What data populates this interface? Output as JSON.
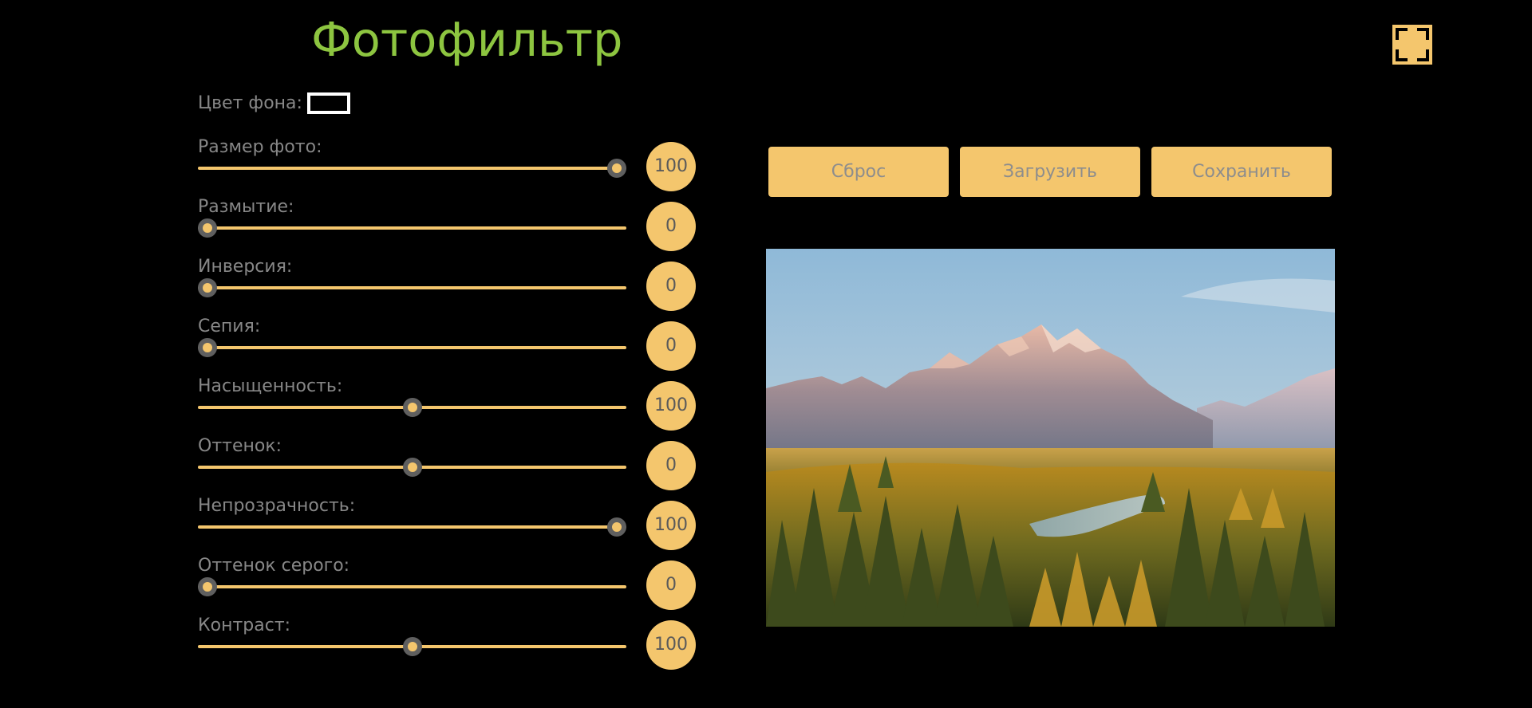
{
  "header": {
    "title": "Фотофильтр",
    "fullscreen_icon": "fullscreen-icon"
  },
  "background": {
    "label": "Цвет фона:",
    "color": "#000000"
  },
  "controls": [
    {
      "label": "Размер фото:",
      "value": "100",
      "min": 0,
      "max": 100,
      "level": 1.0
    },
    {
      "label": "Размытие:",
      "value": "0",
      "min": 0,
      "max": 100,
      "level": 0.0
    },
    {
      "label": "Инверсия:",
      "value": "0",
      "min": 0,
      "max": 100,
      "level": 0.0
    },
    {
      "label": "Сепия:",
      "value": "0",
      "min": 0,
      "max": 100,
      "level": 0.0
    },
    {
      "label": "Насыщенность:",
      "value": "100",
      "min": 0,
      "max": 200,
      "level": 0.5
    },
    {
      "label": "Оттенок:",
      "value": "0",
      "min": -180,
      "max": 180,
      "level": 0.5
    },
    {
      "label": "Непрозрачность:",
      "value": "100",
      "min": 0,
      "max": 100,
      "level": 1.0
    },
    {
      "label": "Оттенок серого:",
      "value": "0",
      "min": 0,
      "max": 100,
      "level": 0.0
    },
    {
      "label": "Контраст:",
      "value": "100",
      "min": 0,
      "max": 200,
      "level": 0.5
    }
  ],
  "actions": {
    "reset_label": "Сброс",
    "load_label": "Загрузить",
    "save_label": "Сохранить"
  },
  "photo": {
    "subject": "mountain-river-landscape"
  },
  "colors": {
    "accent": "#f4c66d",
    "title": "#8dc540",
    "label": "#878787",
    "background": "#000000"
  }
}
